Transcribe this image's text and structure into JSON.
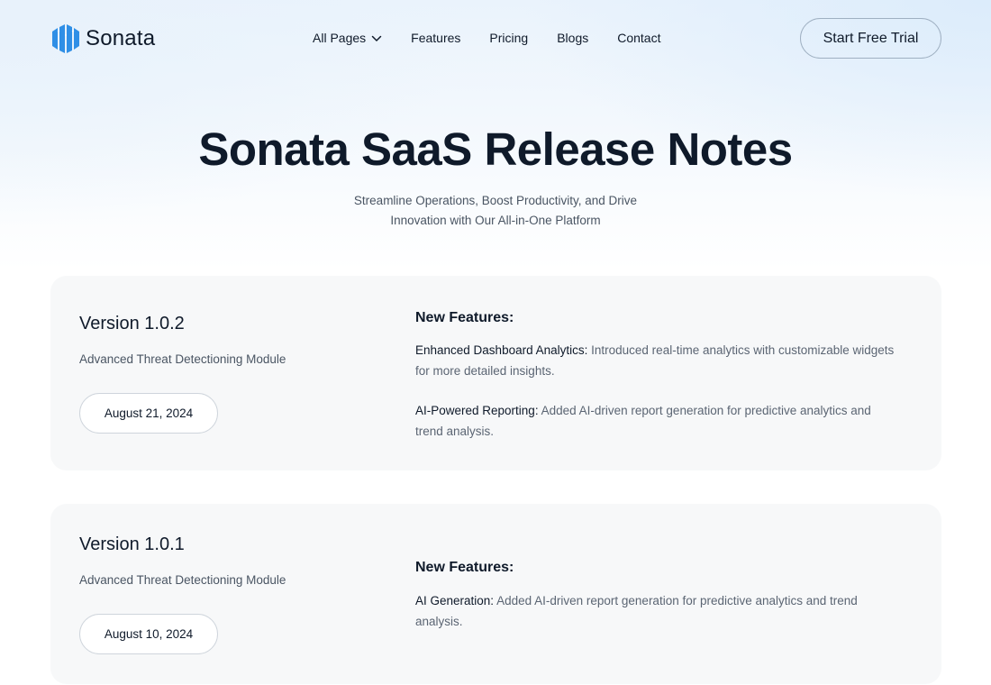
{
  "header": {
    "logo_text": "Sonata",
    "nav": [
      {
        "label": "All Pages",
        "has_dropdown": true
      },
      {
        "label": "Features"
      },
      {
        "label": "Pricing"
      },
      {
        "label": "Blogs"
      },
      {
        "label": "Contact"
      }
    ],
    "cta_label": "Start Free Trial"
  },
  "hero": {
    "title": "Sonata SaaS Release Notes",
    "subtitle_line1": "Streamline Operations, Boost Productivity, and Drive",
    "subtitle_line2": "Innovation with Our All-in-One Platform"
  },
  "releases": [
    {
      "version": "Version 1.0.2",
      "module": "Advanced Threat Detectioning Module",
      "date": "August 21, 2024",
      "features_heading": "New Features:",
      "features": [
        {
          "name": "Enhanced Dashboard Analytics:",
          "text": "Introduced real-time analytics with customizable widgets for more detailed insights."
        },
        {
          "name": "AI-Powered Reporting:",
          "text": "Added AI-driven report generation for predictive analytics and trend analysis."
        }
      ]
    },
    {
      "version": "Version 1.0.1",
      "module": "Advanced Threat Detectioning Module",
      "date": "August 10, 2024",
      "features_heading": "New Features:",
      "features": [
        {
          "name": "AI Generation:",
          "text": "Added AI-driven report generation for predictive analytics and trend analysis."
        }
      ]
    }
  ],
  "colors": {
    "primary_text": "#0f1a2a",
    "muted_text": "#5b6573",
    "logo_blue": "#2f8fe6",
    "card_bg": "#f7f8f9"
  },
  "icons": {
    "logo": "sonata-logo-icon",
    "dropdown": "chevron-down-icon"
  }
}
